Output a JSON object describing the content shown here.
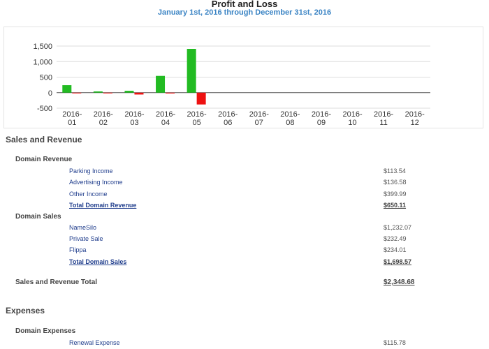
{
  "report": {
    "title": "Profit and Loss",
    "subtitle": "January 1st, 2016 through December 31st, 2016"
  },
  "chart_data": {
    "type": "bar",
    "categories": [
      "2016-\n01",
      "2016-\n02",
      "2016-\n03",
      "2016-\n04",
      "2016-\n05",
      "2016-\n06",
      "2016-\n07",
      "2016-\n08",
      "2016-\n09",
      "2016-\n10",
      "2016-\n11",
      "2016-\n12"
    ],
    "series": [
      {
        "color": "#22bb22",
        "values": [
          240,
          40,
          60,
          540,
          1410,
          0,
          0,
          0,
          0,
          0,
          0,
          0
        ]
      },
      {
        "color": "#ee1111",
        "values": [
          -15,
          -20,
          -60,
          -25,
          -380,
          0,
          0,
          0,
          0,
          0,
          0,
          0
        ]
      }
    ],
    "yticks": [
      "1,500",
      "1,000",
      "500",
      "0",
      "-500"
    ],
    "ytick_values": [
      1500,
      1000,
      500,
      0,
      -500
    ],
    "ylim": [
      -500,
      1500
    ],
    "grid": true
  },
  "sales": {
    "title": "Sales and Revenue",
    "domain_revenue": {
      "title": "Domain Revenue",
      "items": [
        {
          "label": "Parking Income",
          "amount": "$113.54"
        },
        {
          "label": "Advertising Income",
          "amount": "$136.58"
        },
        {
          "label": "Other Income",
          "amount": "$399.99"
        }
      ],
      "total_label": "Total Domain Revenue",
      "total_amount": "$650.11"
    },
    "domain_sales": {
      "title": "Domain Sales",
      "items": [
        {
          "label": "NameSilo",
          "amount": "$1,232.07"
        },
        {
          "label": "Private Sale",
          "amount": "$232.49"
        },
        {
          "label": "Flippa",
          "amount": "$234.01"
        }
      ],
      "total_label": "Total Domain Sales",
      "total_amount": "$1,698.57"
    },
    "total_label": "Sales and Revenue Total",
    "total_amount": "$2,348.68"
  },
  "expenses": {
    "title": "Expenses",
    "domain_expenses": {
      "title": "Domain Expenses",
      "items": [
        {
          "label": "Renewal Expense",
          "amount": "$115.78"
        }
      ]
    }
  }
}
